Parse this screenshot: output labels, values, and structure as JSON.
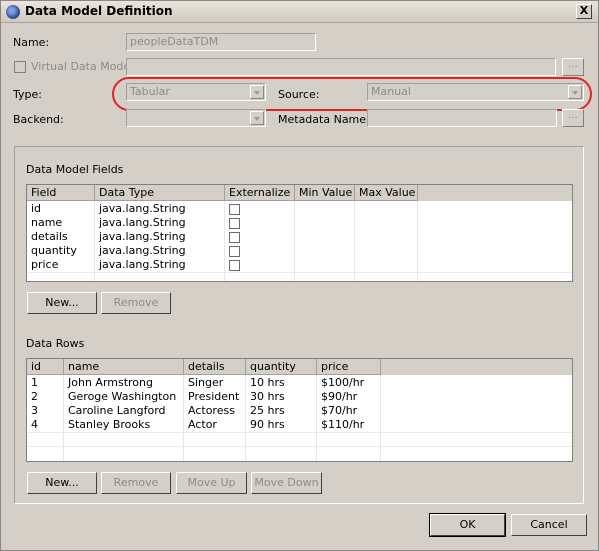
{
  "window": {
    "title": "Data Model Definition",
    "close_label": "X",
    "icon": "eclipse-icon"
  },
  "form": {
    "name_label": "Name:",
    "name_value": "peopleDataTDM",
    "virtual_label": "Virtual Data Model",
    "type_label": "Type:",
    "type_value": "Tabular",
    "source_label": "Source:",
    "source_value": "Manual",
    "backend_label": "Backend:",
    "backend_value": "",
    "metadata_label": "Metadata Name:",
    "metadata_value": "",
    "browse_label": "..."
  },
  "fields_section": {
    "title": "Data Model Fields",
    "columns": [
      "Field",
      "Data Type",
      "Externalize",
      "Min Value",
      "Max Value"
    ],
    "rows": [
      {
        "field": "id",
        "type": "java.lang.String"
      },
      {
        "field": "name",
        "type": "java.lang.String"
      },
      {
        "field": "details",
        "type": "java.lang.String"
      },
      {
        "field": "quantity",
        "type": "java.lang.String"
      },
      {
        "field": "price",
        "type": "java.lang.String"
      }
    ],
    "new_label": "New...",
    "remove_label": "Remove"
  },
  "rows_section": {
    "title": "Data Rows",
    "columns": [
      "id",
      "name",
      "details",
      "quantity",
      "price"
    ],
    "rows": [
      {
        "id": "1",
        "name": "John Armstrong",
        "details": "Singer",
        "quantity": "10 hrs",
        "price": "$100/hr"
      },
      {
        "id": "2",
        "name": "Geroge Washington",
        "details": "President",
        "quantity": "30 hrs",
        "price": "$90/hr"
      },
      {
        "id": "3",
        "name": "Caroline Langford",
        "details": "Actoress",
        "quantity": "25 hrs",
        "price": "$70/hr"
      },
      {
        "id": "4",
        "name": "Stanley Brooks",
        "details": "Actor",
        "quantity": "90 hrs",
        "price": "$110/hr"
      }
    ],
    "new_label": "New...",
    "remove_label": "Remove",
    "moveup_label": "Move Up",
    "movedown_label": "Move Down"
  },
  "footer": {
    "ok_label": "OK",
    "cancel_label": "Cancel"
  },
  "colors": {
    "highlight": "#e0232b",
    "dialog_bg": "#d4d0c8"
  }
}
